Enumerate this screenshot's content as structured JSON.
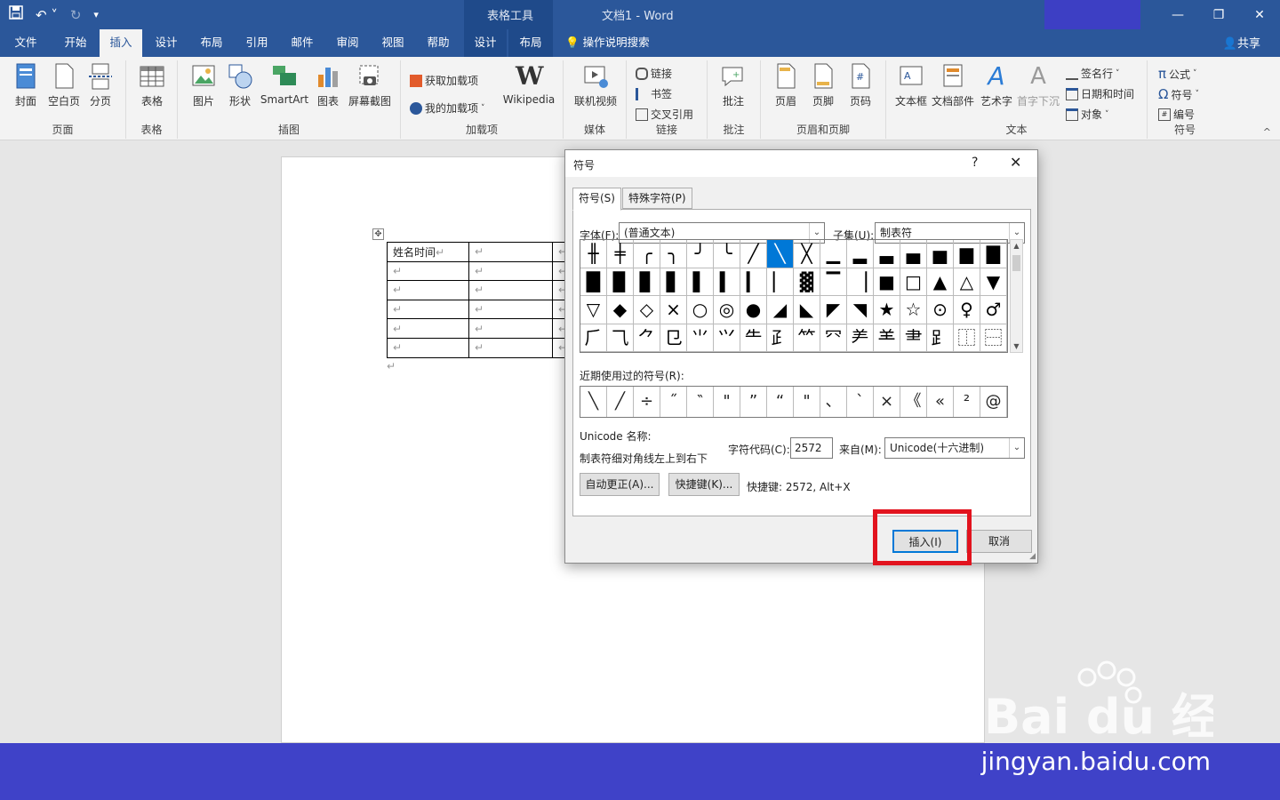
{
  "titlebar": {
    "context_tool": "表格工具",
    "doc_title": "文档1 - Word",
    "qat_icons": [
      "save-icon",
      "undo-icon",
      "redo-icon",
      "customize-icon"
    ],
    "win_controls": [
      "ribbon-display-icon",
      "minimize-icon",
      "restore-icon",
      "close-icon"
    ]
  },
  "tabs": [
    {
      "label": "文件"
    },
    {
      "label": "开始"
    },
    {
      "label": "插入"
    },
    {
      "label": "设计"
    },
    {
      "label": "布局"
    },
    {
      "label": "引用"
    },
    {
      "label": "邮件"
    },
    {
      "label": "审阅"
    },
    {
      "label": "视图"
    },
    {
      "label": "帮助"
    },
    {
      "label": "设计"
    },
    {
      "label": "布局"
    }
  ],
  "tell_me": "操作说明搜索",
  "share": "共享",
  "ribbon": {
    "pages": {
      "cover": "封面",
      "blank": "空白页",
      "break": "分页",
      "label": "页面"
    },
    "tables": {
      "table": "表格",
      "label": "表格"
    },
    "illustrations": {
      "picture": "图片",
      "shapes": "形状",
      "smartart": "SmartArt",
      "chart": "图表",
      "screenshot": "屏幕截图",
      "label": "插图"
    },
    "addins": {
      "get": "获取加载项",
      "my": "我的加载项",
      "wiki": "Wikipedia",
      "label": "加载项"
    },
    "media": {
      "video": "联机视频",
      "label": "媒体"
    },
    "links": {
      "link": "链接",
      "bookmark": "书签",
      "crossref": "交叉引用",
      "label": "链接"
    },
    "comments": {
      "comment": "批注",
      "label": "批注"
    },
    "header_footer": {
      "header": "页眉",
      "footer": "页脚",
      "pagenum": "页码",
      "label": "页眉和页脚"
    },
    "text": {
      "textbox": "文本框",
      "quickparts": "文档部件",
      "wordart": "艺术字",
      "dropcap": "首字下沉",
      "signature": "签名行",
      "datetime": "日期和时间",
      "object": "对象",
      "label": "文本"
    },
    "symbols": {
      "equation": "公式",
      "symbol": "符号",
      "number": "编号",
      "label": "符号"
    }
  },
  "document": {
    "first_cell": "姓名时间",
    "para_mark": "↵",
    "rows": 6
  },
  "dialog": {
    "title": "符号",
    "help": "?",
    "close": "✕",
    "tab_symbols": "符号(S)",
    "tab_special": "特殊字符(P)",
    "font_label": "字体(F):",
    "font_value": "(普通文本)",
    "subset_label": "子集(U):",
    "subset_value": "制表符",
    "symbols": [
      "╫",
      "╪",
      "╭",
      "╮",
      "╯",
      "╰",
      "╱",
      "╲",
      "╳",
      "▁",
      "▂",
      "▃",
      "▄",
      "▅",
      "▆",
      "▇",
      "█",
      "▉",
      "▊",
      "▋",
      "▌",
      "▍",
      "▎",
      "▏",
      "▓",
      "▔",
      "▕",
      "■",
      "□",
      "▲",
      "△",
      "▼",
      "▽",
      "◆",
      "◇",
      "×",
      "○",
      "◎",
      "●",
      "◢",
      "◣",
      "◤",
      "◥",
      "★",
      "☆",
      "⊙",
      "♀",
      "♂",
      "⺁",
      "⺄",
      "⺈",
      "⺋",
      "⺌",
      "⺍",
      "⺧",
      "⺪",
      "⺮",
      "⺳",
      "⺶",
      "⺷",
      "⺻",
      "⻊",
      "⿰",
      "⿱"
    ],
    "selected_index": 7,
    "recent_label": "近期使用过的符号(R):",
    "recent": [
      "╲",
      "╱",
      "÷",
      "˝",
      "‶",
      "\"",
      "”",
      "“",
      "\"",
      "、",
      "`",
      "×",
      "《",
      "«",
      "²",
      "@"
    ],
    "unicode_name_label": "Unicode 名称:",
    "unicode_name": "制表符细对角线左上到右下",
    "char_code_label": "字符代码(C):",
    "char_code": "2572",
    "from_label": "来自(M):",
    "from_value": "Unicode(十六进制)",
    "autocorrect": "自动更正(A)...",
    "shortcut_key": "快捷键(K)...",
    "shortcut_text": "快捷键: 2572, Alt+X",
    "insert": "插入(I)",
    "cancel": "取消"
  },
  "watermark": {
    "text": "jingyan.baidu.com",
    "logo_text": "Bai du 经验"
  }
}
